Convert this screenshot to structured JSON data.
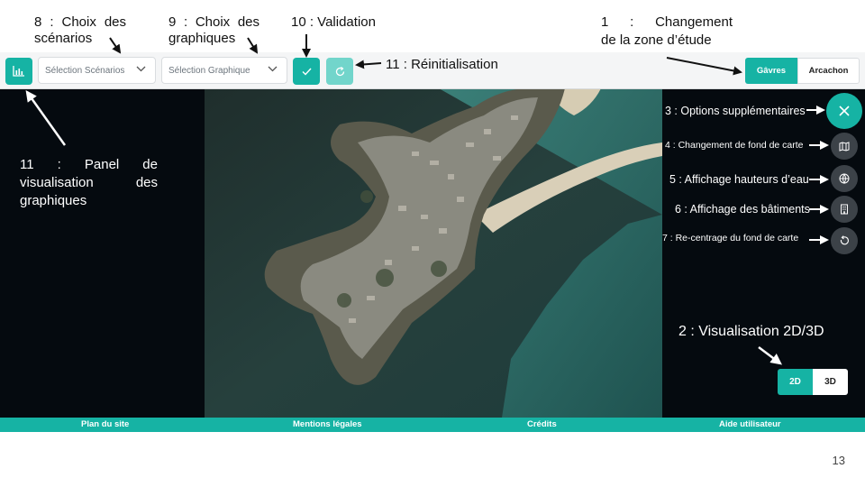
{
  "colors": {
    "accent": "#16b3a4",
    "accent_light": "#72d5cb",
    "dark_bg": "#050a0f",
    "round_btn": "#3c4248"
  },
  "toolbar": {
    "chart_panel_icon": "bar-chart-icon",
    "scenario_select": {
      "value": "Sélection Scénarios"
    },
    "chart_select": {
      "value": "Sélection Graphique"
    },
    "validate_icon": "check-icon",
    "reset_icon": "refresh-icon",
    "zones": [
      {
        "label": "Gâvres",
        "active": true
      },
      {
        "label": "Arcachon",
        "active": false
      }
    ]
  },
  "annotations": {
    "a8_line1": "8 : Choix des",
    "a8_line2": "scénarios",
    "a9_line1": "9 : Choix des",
    "a9_line2": "graphiques",
    "a10": "10 : Validation",
    "a11_reset": "11 : Réinitialisation",
    "a1_line1": "1 : Changement",
    "a1_line2": "de la zone d’étude",
    "a11_panel_line1": "11 : Panel de",
    "a11_panel_line2": "visualisation des",
    "a11_panel_line3": "graphiques",
    "a3": "3 : Options supplémentaires",
    "a4": "4 : Changement de fond de carte",
    "a5": "5 : Affichage hauteurs d’eau",
    "a6": "6 : Affichage des bâtiments",
    "a7": "7 : Re-centrage du fond de carte",
    "a2": "2 : Visualisation 2D/3D"
  },
  "map_tools": {
    "close_icon": "close-icon",
    "basemap_icon": "map-icon",
    "water_icon": "globe-icon",
    "buildings_icon": "building-icon",
    "recenter_icon": "recenter-icon"
  },
  "view_toggle": [
    {
      "label": "2D",
      "active": true
    },
    {
      "label": "3D",
      "active": false
    }
  ],
  "footer": {
    "links": [
      "Plan du site",
      "Mentions légales",
      "Crédits",
      "Aide utilisateur"
    ]
  },
  "slide": {
    "page_number": "13"
  }
}
